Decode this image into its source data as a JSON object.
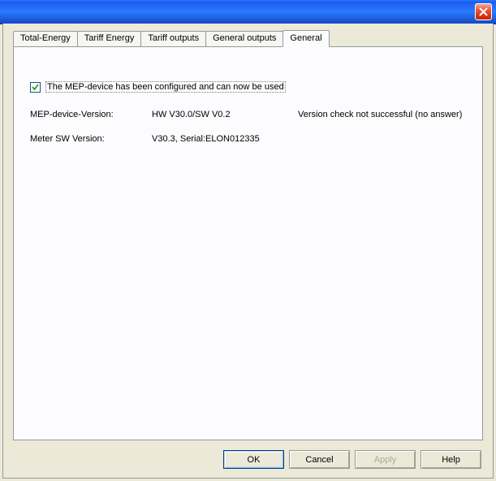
{
  "titlebar": {
    "close_icon": "close"
  },
  "tabs": [
    {
      "label": "Total-Energy",
      "active": false
    },
    {
      "label": "Tariff Energy",
      "active": false
    },
    {
      "label": "Tariff outputs",
      "active": false
    },
    {
      "label": "General outputs",
      "active": false
    },
    {
      "label": "General",
      "active": true
    }
  ],
  "general": {
    "checkbox_checked": true,
    "checkbox_label": "The MEP-device has been configured and can now be used",
    "row1_label": "MEP-device-Version:",
    "row1_value": "HW V30.0/SW V0.2",
    "row1_status": "Version check not successful (no answer)",
    "row2_label": "Meter SW Version:",
    "row2_value": "V30.3, Serial:ELON012335"
  },
  "buttons": {
    "ok": "OK",
    "cancel": "Cancel",
    "apply": "Apply",
    "help": "Help"
  }
}
